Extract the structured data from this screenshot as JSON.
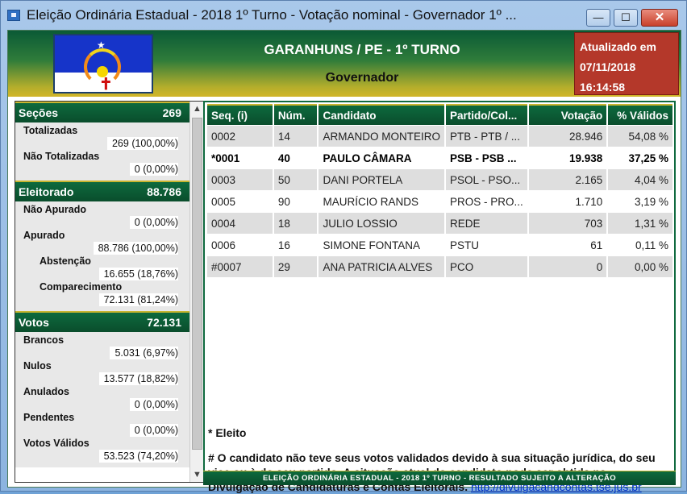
{
  "window": {
    "title": "Eleição Ordinária Estadual - 2018 1º Turno - Votação nominal - Governador 1º ...",
    "min_label": "—",
    "max_label": "☐",
    "close_label": "✕"
  },
  "header": {
    "city": "GARANHUNS / PE - 1º TURNO",
    "office": "Governador",
    "updated_label": "Atualizado em",
    "updated_date": "07/11/2018",
    "updated_time": "16:14:58"
  },
  "sidebar": {
    "secoes": {
      "label": "Seções",
      "value": "269"
    },
    "totalizadas": {
      "label": "Totalizadas",
      "value": "269 (100,00%)"
    },
    "nao_totalizadas": {
      "label": "Não Totalizadas",
      "value": "0 (0,00%)"
    },
    "eleitorado": {
      "label": "Eleitorado",
      "value": "88.786"
    },
    "nao_apurado": {
      "label": "Não Apurado",
      "value": "0 (0,00%)"
    },
    "apurado": {
      "label": "Apurado",
      "value": "88.786 (100,00%)"
    },
    "abstencao": {
      "label": "Abstenção",
      "value": "16.655 (18,76%)"
    },
    "comparecimento": {
      "label": "Comparecimento",
      "value": "72.131 (81,24%)"
    },
    "votos": {
      "label": "Votos",
      "value": "72.131"
    },
    "brancos": {
      "label": "Brancos",
      "value": "5.031 (6,97%)"
    },
    "nulos": {
      "label": "Nulos",
      "value": "13.577 (18,82%)"
    },
    "anulados": {
      "label": "Anulados",
      "value": "0 (0,00%)"
    },
    "pendentes": {
      "label": "Pendentes",
      "value": "0 (0,00%)"
    },
    "votos_validos": {
      "label": "Votos Válidos",
      "value": "53.523 (74,20%)"
    }
  },
  "table": {
    "headers": [
      "Seq.   (i)",
      "Núm.",
      "Candidato",
      "Partido/Col...",
      "Votação",
      "% Válidos"
    ],
    "rows": [
      [
        "0002",
        "14",
        "ARMANDO MONTEIRO",
        "PTB - PTB / ...",
        "28.946",
        "54,08 %"
      ],
      [
        "*0001",
        "40",
        "PAULO CÂMARA",
        "PSB - PSB ...",
        "19.938",
        "37,25 %"
      ],
      [
        "0003",
        "50",
        "DANI PORTELA",
        "PSOL - PSO...",
        "2.165",
        "4,04 %"
      ],
      [
        "0005",
        "90",
        "MAURÍCIO RANDS",
        "PROS - PRO...",
        "1.710",
        "3,19 %"
      ],
      [
        "0004",
        "18",
        "JULIO LOSSIO",
        "REDE",
        "703",
        "1,31 %"
      ],
      [
        "0006",
        "16",
        "SIMONE FONTANA",
        "PSTU",
        "61",
        "0,11 %"
      ],
      [
        "#0007",
        "29",
        "ANA PATRICIA ALVES",
        "PCO",
        "0",
        "0,00 %"
      ]
    ]
  },
  "notes": {
    "eleito": "* Eleito",
    "text": "# O candidato não teve seus votos validados devido à sua situação jurídica, do seu vice ou à do seu partido. A situação atual do candidato pode ser obtida na Divulgação de Candidaturas e Contas Eleitorais.",
    "link": "http://divulgacandcontas.tse.jus.br"
  },
  "footer": "ELEIÇÃO ORDINÁRIA ESTADUAL - 2018 1º TURNO - RESULTADO SUJEITO A ALTERAÇÃO",
  "colors": {
    "header_green": "#0a5a36",
    "header_gold": "#d2b527",
    "updated_red": "#b4382a",
    "row_gray": "#dedede"
  }
}
